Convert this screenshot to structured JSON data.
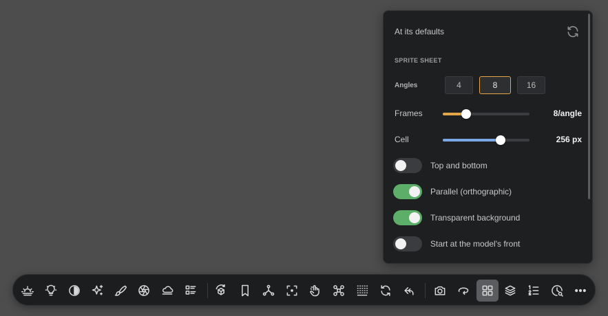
{
  "panel": {
    "header": "At its defaults",
    "section_title": "SPRITE SHEET",
    "angles": {
      "label": "Angles",
      "options": [
        "4",
        "8",
        "16"
      ],
      "selected": "8"
    },
    "frames": {
      "label": "Frames",
      "value_text": "8/angle",
      "fraction": 0.27,
      "fill_color": "#e5a64a"
    },
    "cell": {
      "label": "Cell",
      "value_text": "256 px",
      "fraction": 0.67,
      "fill_color": "#7aa7e6"
    },
    "toggles": [
      {
        "label": "Top and bottom",
        "on": false
      },
      {
        "label": "Parallel (orthographic)",
        "on": true
      },
      {
        "label": "Transparent background",
        "on": true
      },
      {
        "label": "Start at the model's front",
        "on": false
      }
    ],
    "accent_color": "#e5a64a",
    "toggle_on_color": "#5cae68"
  },
  "toolbar": {
    "icons": [
      "sunrise-icon",
      "lightbulb-icon",
      "contrast-icon",
      "sparkles-icon",
      "brush-icon",
      "aperture-icon",
      "cloud-icon",
      "list-grid-icon",
      "cube-rotate-icon",
      "bookmark-icon",
      "nodes-icon",
      "focus-icon",
      "hand-pointer-icon",
      "drone-icon",
      "dotted-grid-icon",
      "refresh-icon",
      "undo-arrow-icon",
      "camera-icon",
      "orbit-icon",
      "grid-icon",
      "layers-icon",
      "numbered-list-icon",
      "clock-search-icon",
      "more-icon"
    ],
    "active_icon": "grid-icon"
  }
}
